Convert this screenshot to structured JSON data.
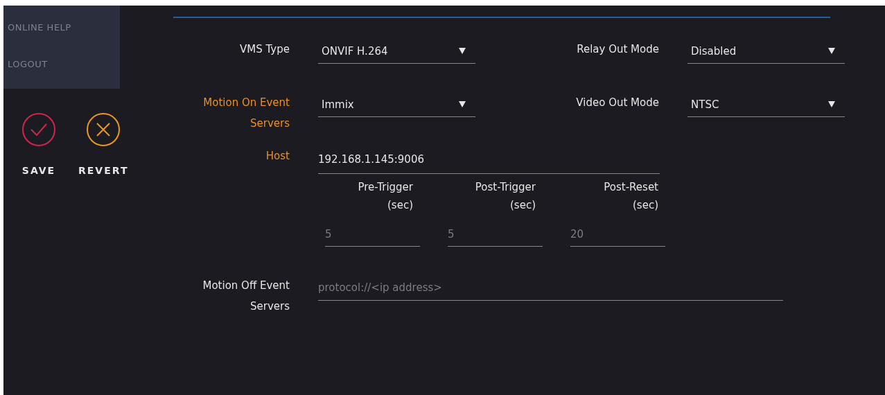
{
  "menu": {
    "items": [
      {
        "label": "ONLINE HELP"
      },
      {
        "label": "LOGOUT"
      }
    ]
  },
  "actions": [
    {
      "kind": "save",
      "label": "SAVE"
    },
    {
      "kind": "revert",
      "label": "REVERT"
    }
  ],
  "form": {
    "rows": [
      {
        "kind": "pair",
        "fields": [
          {
            "label": "VMS Type",
            "highlighted": false,
            "value": "ONVIF H.264"
          },
          {
            "label": "Relay Out Mode",
            "highlighted": false,
            "value": "Disabled"
          }
        ]
      },
      {
        "kind": "pair",
        "fields": [
          {
            "label": "Motion On Event Servers",
            "highlighted": true,
            "value": "Immix"
          },
          {
            "label": "Video Out Mode",
            "highlighted": false,
            "value": "NTSC"
          }
        ]
      },
      {
        "kind": "text",
        "label": "Host",
        "highlighted": true,
        "value": "192.168.1.145:9006"
      },
      {
        "kind": "triggers",
        "fields": [
          {
            "label": "Pre-Trigger",
            "unit": "(sec)",
            "placeholder": "5"
          },
          {
            "label": "Post-Trigger",
            "unit": "(sec)",
            "placeholder": "5"
          },
          {
            "label": "Post-Reset",
            "unit": "(sec)",
            "placeholder": "20"
          }
        ]
      },
      {
        "kind": "wide",
        "label": "Motion Off Event Servers",
        "highlighted": false,
        "placeholder": "protocol://<ip address>"
      }
    ]
  }
}
